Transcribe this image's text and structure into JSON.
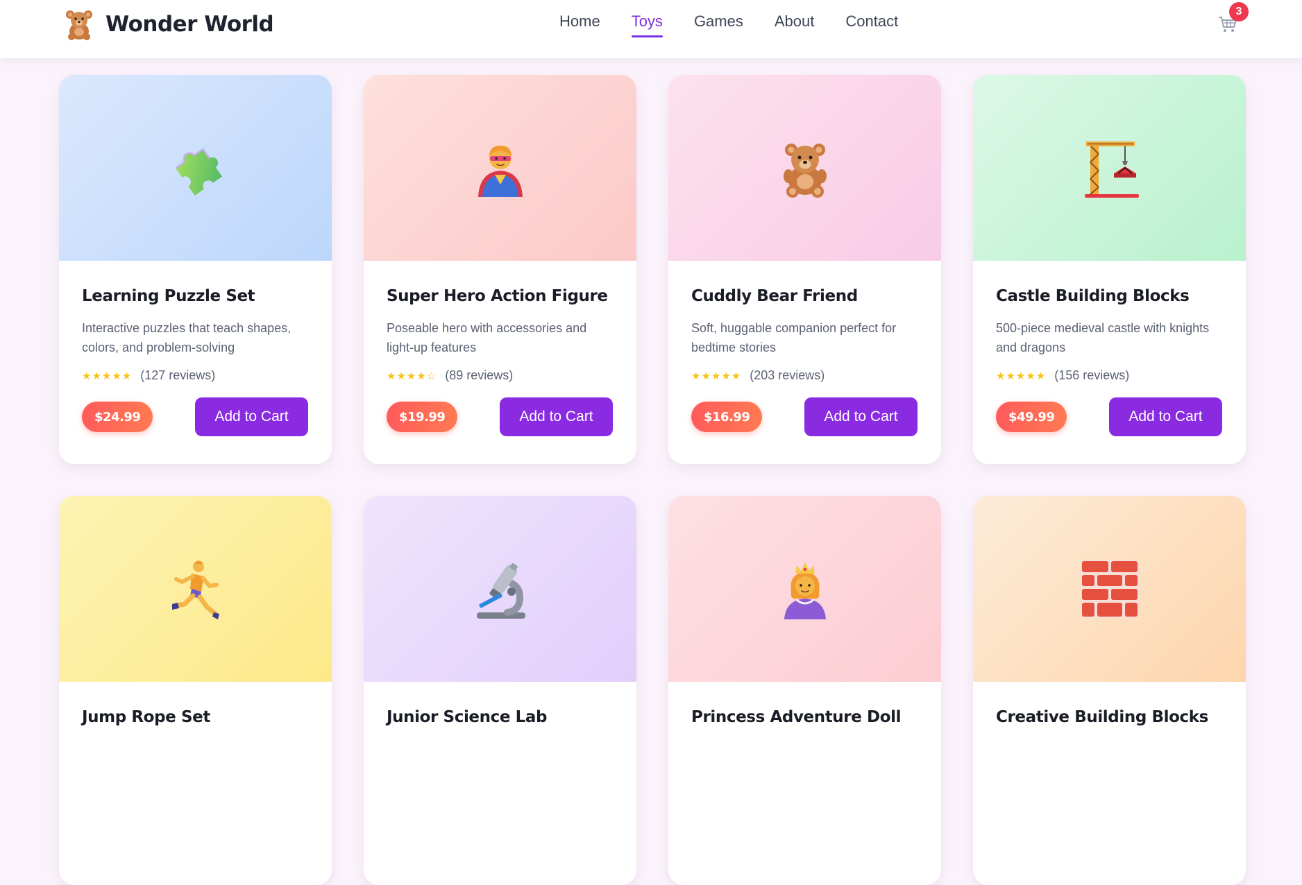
{
  "header": {
    "brand_name": "Wonder World",
    "logo_icon": "teddy-bear-icon",
    "nav": [
      {
        "label": "Home",
        "active": false
      },
      {
        "label": "Toys",
        "active": true
      },
      {
        "label": "Games",
        "active": false
      },
      {
        "label": "About",
        "active": false
      },
      {
        "label": "Contact",
        "active": false
      }
    ],
    "cart_icon": "shopping-cart-icon",
    "cart_count": "3"
  },
  "colors": {
    "accent": "#8a2be2",
    "price": "#ff6152",
    "badge": "#f0384c",
    "star": "#f7c21a"
  },
  "products": [
    {
      "title": "Learning Puzzle Set",
      "description": "Interactive puzzles that teach shapes, colors, and problem-solving",
      "stars": "★★★★★",
      "rating": 5,
      "reviews": "(127 reviews)",
      "price": "$24.99",
      "button": "Add to Cart",
      "icon": "puzzle-piece-icon"
    },
    {
      "title": "Super Hero Action Figure",
      "description": "Poseable hero with accessories and light-up features",
      "stars": "★★★★☆",
      "rating": 4,
      "reviews": "(89 reviews)",
      "price": "$19.99",
      "button": "Add to Cart",
      "icon": "superhero-icon"
    },
    {
      "title": "Cuddly Bear Friend",
      "description": "Soft, huggable companion perfect for bedtime stories",
      "stars": "★★★★★",
      "rating": 5,
      "reviews": "(203 reviews)",
      "price": "$16.99",
      "button": "Add to Cart",
      "icon": "teddy-bear-icon"
    },
    {
      "title": "Castle Building Blocks",
      "description": "500-piece medieval castle with knights and dragons",
      "stars": "★★★★★",
      "rating": 5,
      "reviews": "(156 reviews)",
      "price": "$49.99",
      "button": "Add to Cart",
      "icon": "construction-crane-icon"
    },
    {
      "title": "Jump Rope Set",
      "icon": "running-person-icon"
    },
    {
      "title": "Junior Science Lab",
      "icon": "microscope-icon"
    },
    {
      "title": "Princess Adventure Doll",
      "icon": "princess-icon"
    },
    {
      "title": "Creative Building Blocks",
      "icon": "brick-icon"
    }
  ]
}
